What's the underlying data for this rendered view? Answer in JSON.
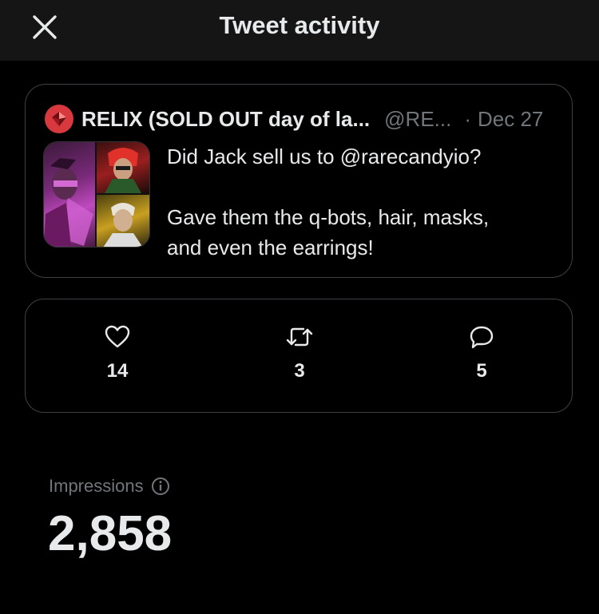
{
  "header": {
    "title": "Tweet activity",
    "close_icon": "close-icon"
  },
  "tweet": {
    "author_name": "RELIX (SOLD OUT day of la...",
    "author_handle": "@RE...",
    "separator": "·",
    "date": "Dec 27",
    "text_line_1": "Did Jack sell us to @rarecandyio?",
    "text_line_2": "Gave them the q-bots, hair, masks,",
    "text_line_3": "and even the earrings!",
    "avatar_color": "#d8393f"
  },
  "stats": {
    "likes": {
      "icon": "heart-icon",
      "count": "14"
    },
    "retweets": {
      "icon": "retweet-icon",
      "count": "3"
    },
    "replies": {
      "icon": "reply-icon",
      "count": "5"
    }
  },
  "impressions": {
    "label": "Impressions",
    "info_icon": "info-icon",
    "value": "2,858"
  },
  "colors": {
    "background": "#000000",
    "header_bg": "#151515",
    "text_primary": "#e7e9ea",
    "text_secondary": "#71767b",
    "border": "#3d4145"
  }
}
